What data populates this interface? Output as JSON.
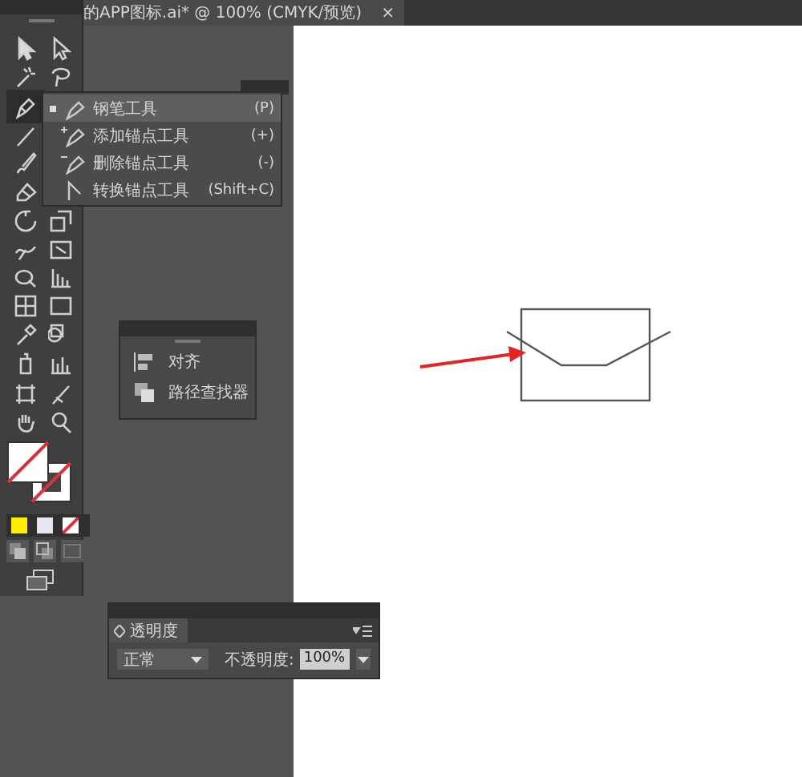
{
  "document_tab": {
    "title": "的APP图标.ai* @ 100% (CMYK/预览)",
    "close": "×"
  },
  "tool_flyout": {
    "items": [
      {
        "label": "钢笔工具",
        "shortcut": "(P)",
        "selected": true
      },
      {
        "label": "添加锚点工具",
        "shortcut": "(+)",
        "selected": false
      },
      {
        "label": "删除锚点工具",
        "shortcut": "(-)",
        "selected": false
      },
      {
        "label": "转换锚点工具",
        "shortcut": "(Shift+C)",
        "selected": false
      }
    ]
  },
  "align_panel": {
    "items": [
      {
        "label": "对齐"
      },
      {
        "label": "路径查找器"
      }
    ]
  },
  "transparency_panel": {
    "tab": "透明度",
    "blend_mode": "正常",
    "opacity_label": "不透明度:",
    "opacity_value": "100%"
  }
}
